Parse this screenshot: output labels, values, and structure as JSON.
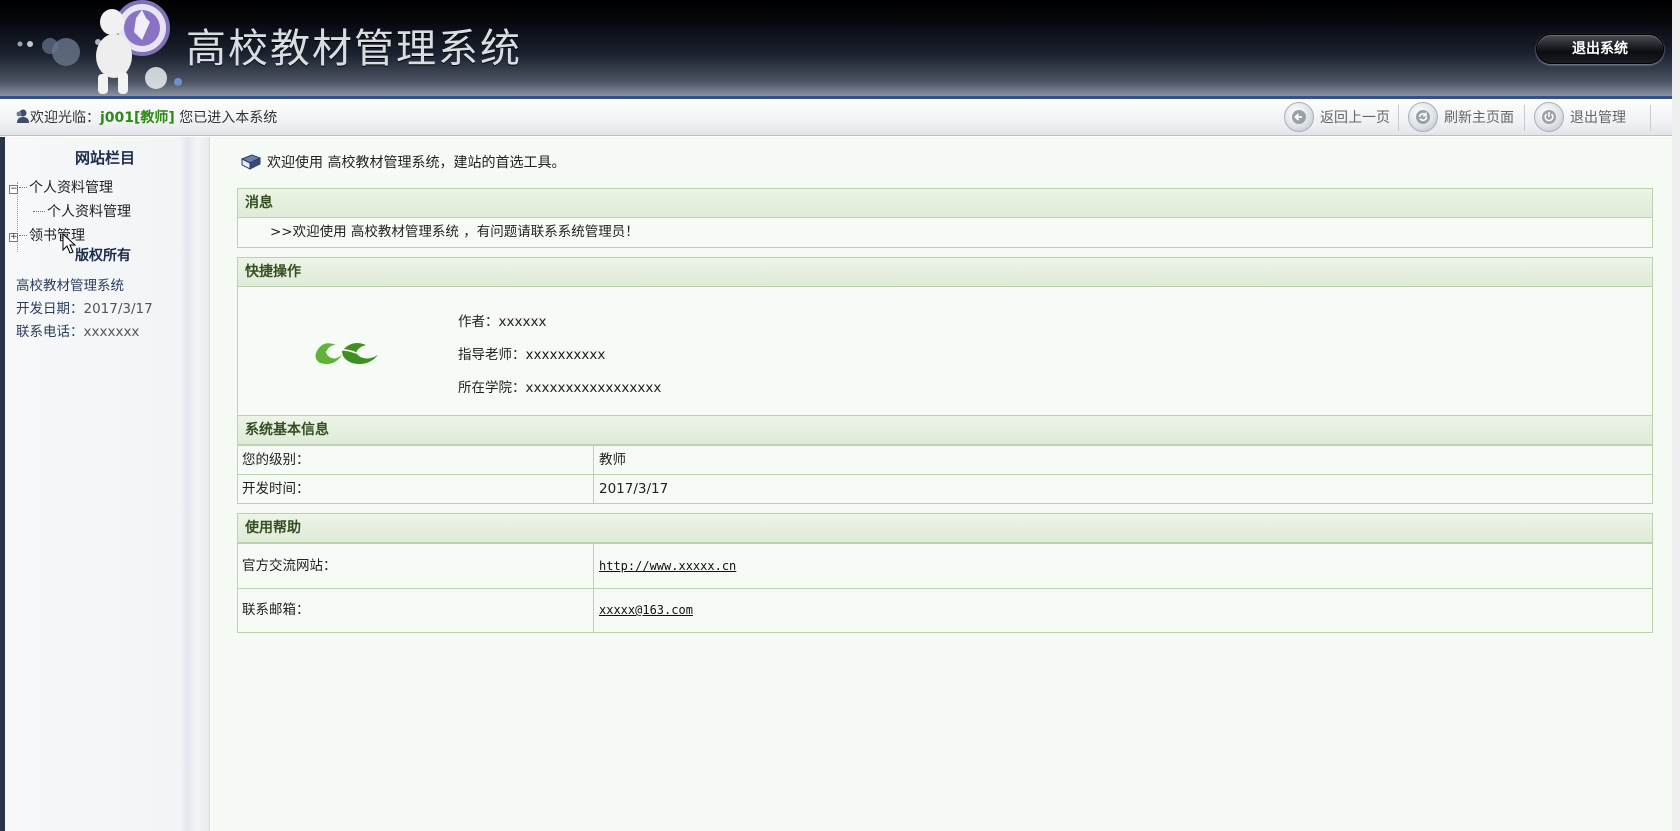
{
  "header": {
    "title": "高校教材管理系统",
    "logout_label": "退出系统"
  },
  "toolbar": {
    "welcome_prefix": "欢迎光临：",
    "username": "j001[教师]",
    "welcome_suffix": " 您已进入本系统",
    "back_label": "返回上一页",
    "refresh_label": "刷新主页面",
    "exit_label": "退出管理"
  },
  "sidebar": {
    "title": "网站栏目",
    "tree": [
      {
        "label": "个人资料管理",
        "expanded": true,
        "children": [
          "个人资料管理"
        ]
      },
      {
        "label": "领书管理",
        "expanded": false
      }
    ],
    "copyright_title": "版权所有",
    "info": {
      "system_name": "高校教材管理系统",
      "dev_date_label": "开发日期：",
      "dev_date": "2017/3/17",
      "phone_label": "联系电话：",
      "phone": "xxxxxxx"
    }
  },
  "main": {
    "intro": "欢迎使用 高校教材管理系统，建站的首选工具。",
    "message_panel": {
      "title": "消息",
      "text": ">>欢迎使用 高校教材管理系统 ，有问题请联系系统管理员！"
    },
    "quick_panel": {
      "title": "快捷操作",
      "author_label": "作者：",
      "author": "xxxxxx",
      "teacher_label": "指导老师：",
      "teacher": "xxxxxxxxxx",
      "college_label": "所在学院：",
      "college": "xxxxxxxxxxxxxxxxx"
    },
    "sysinfo_panel": {
      "title": "系统基本信息",
      "rows": [
        {
          "key": "您的级别：",
          "value": "教师"
        },
        {
          "key": "开发时间：",
          "value": "2017/3/17"
        }
      ]
    },
    "help_panel": {
      "title": "使用帮助",
      "rows": [
        {
          "key": "官方交流网站：",
          "value": "http://www.xxxxx.cn"
        },
        {
          "key": "联系邮箱：",
          "value": "xxxxx@163.com"
        }
      ]
    }
  }
}
